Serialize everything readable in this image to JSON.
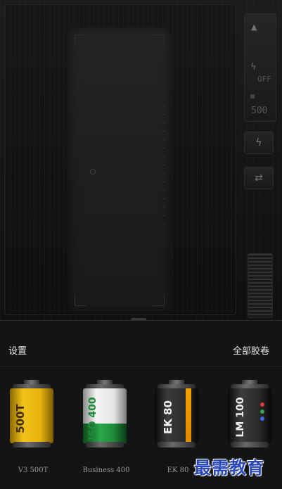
{
  "camera": {
    "flash_state": "OFF",
    "iso_value": "500",
    "mode_icon": "mountain-icon",
    "flash_icon": "bolt-icon",
    "switch_icon": "switch-camera-icon"
  },
  "drawer": {
    "settings_label": "设置",
    "all_films_label": "全部胶卷",
    "films": [
      {
        "name": "V3 500T",
        "canister_text": "500T",
        "color": "#f2c21a"
      },
      {
        "name": "Business 400",
        "canister_text": "ISO 400",
        "color": "#2aa84a"
      },
      {
        "name": "EK 80",
        "canister_text": "EK 80",
        "color": "#f0a000"
      },
      {
        "name": "LM 100",
        "canister_text": "LM 100",
        "color": "#e23a3a"
      }
    ]
  },
  "watermark": "最需教育"
}
